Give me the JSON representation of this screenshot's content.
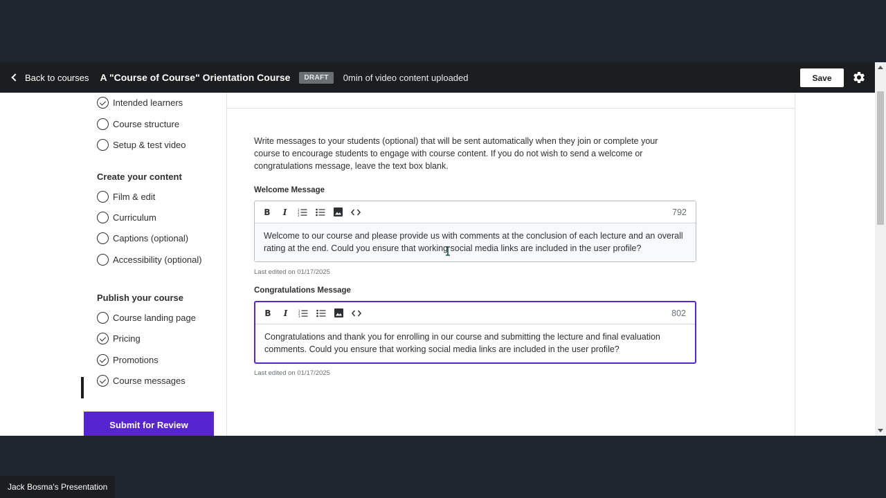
{
  "header": {
    "back_label": "Back to courses",
    "course_title": "A \"Course of Course\" Orientation Course",
    "status_badge": "DRAFT",
    "upload_status": "0min of video content uploaded",
    "save_label": "Save"
  },
  "sidebar": {
    "plan_items": [
      {
        "label": "Intended learners",
        "done": true
      },
      {
        "label": "Course structure",
        "done": false
      },
      {
        "label": "Setup & test video",
        "done": false
      }
    ],
    "create_heading": "Create your content",
    "create_items": [
      {
        "label": "Film & edit",
        "done": false
      },
      {
        "label": "Curriculum",
        "done": false
      },
      {
        "label": "Captions (optional)",
        "done": false
      },
      {
        "label": "Accessibility (optional)",
        "done": false
      }
    ],
    "publish_heading": "Publish your course",
    "publish_items": [
      {
        "label": "Course landing page",
        "done": false
      },
      {
        "label": "Pricing",
        "done": true
      },
      {
        "label": "Promotions",
        "done": true
      },
      {
        "label": "Course messages",
        "done": true,
        "active": true
      }
    ],
    "submit_label": "Submit for Review"
  },
  "main": {
    "intro": "Write messages to your students (optional) that will be sent automatically when they join or complete your course to encourage students to engage with course content. If you do not wish to send a welcome or congratulations message, leave the text box blank.",
    "welcome": {
      "label": "Welcome Message",
      "counter": "792",
      "text": "Welcome to our course and please provide us with comments at the conclusion of each lecture and an overall rating at the end. Could you ensure that working social media links are included in the user profile?",
      "last_edited": "Last edited on 01/17/2025"
    },
    "congrats": {
      "label": "Congratulations Message",
      "counter": "802",
      "text": "Congratulations and thank you for enrolling in our course and submitting the lecture and final evaluation comments. Could you ensure that working social media links are included in the user profile?",
      "last_edited": "Last edited on 01/17/2025"
    },
    "toolbar_icons": [
      "bold-icon",
      "italic-icon",
      "numbered-list-icon",
      "bulleted-list-icon",
      "image-icon",
      "code-icon"
    ]
  },
  "presenter_label": "Jack Bosma's Presentation",
  "colors": {
    "accent": "#5624d0",
    "topbar": "#1c1d1f",
    "background": "#1f2630"
  }
}
